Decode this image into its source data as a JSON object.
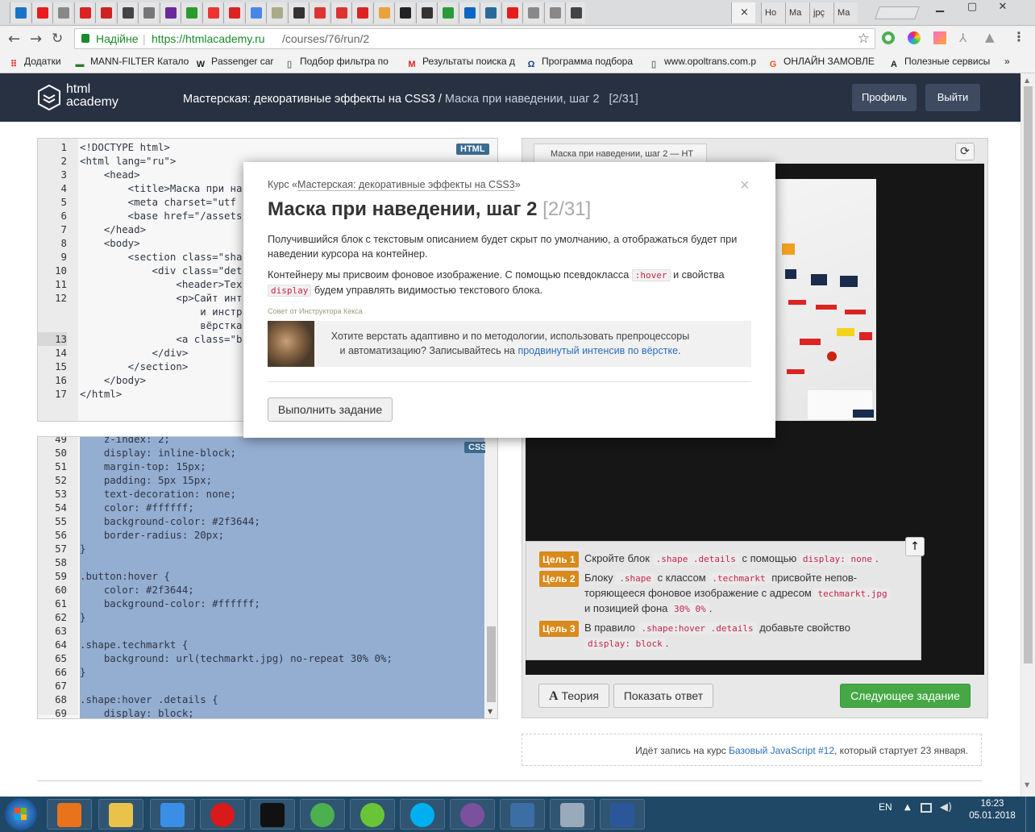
{
  "browser": {
    "tabs": [
      {
        "icon": "s",
        "color": "#1a73c7"
      },
      {
        "icon": "S",
        "color": "#e81c1c"
      },
      {
        "icon": "doc",
        "color": "#888"
      },
      {
        "icon": "M",
        "color": "#d22"
      },
      {
        "icon": "x",
        "color": "#c22"
      },
      {
        "icon": "b",
        "color": "#444"
      },
      {
        "icon": "z",
        "color": "#777"
      },
      {
        "icon": "sq",
        "color": "#6a2a9a"
      },
      {
        "icon": "F",
        "color": "#2a9a2a"
      },
      {
        "icon": "t",
        "color": "#e33"
      },
      {
        "icon": "c",
        "color": "#d22"
      },
      {
        "icon": "G",
        "color": "#4a86e8"
      },
      {
        "icon": "l",
        "color": "#aa8"
      },
      {
        "icon": "h",
        "color": "#333"
      },
      {
        "icon": "y",
        "color": "#d33"
      },
      {
        "icon": "y",
        "color": "#d33"
      },
      {
        "icon": "M",
        "color": "#d22"
      },
      {
        "icon": "o",
        "color": "#e9a33b"
      },
      {
        "icon": ">",
        "color": "#222"
      },
      {
        "icon": "h",
        "color": "#333"
      },
      {
        "icon": "up",
        "color": "#2b9a3b"
      },
      {
        "icon": "in",
        "color": "#0a66c2"
      },
      {
        "icon": "C",
        "color": "#2a6a9a"
      },
      {
        "icon": "S",
        "color": "#e81c1c"
      },
      {
        "icon": "doc",
        "color": "#888"
      },
      {
        "icon": "doc",
        "color": "#888"
      },
      {
        "icon": "sh",
        "color": "#444"
      }
    ],
    "extra_tabs": [
      "Но",
      "Ма",
      "jpç",
      "Ма"
    ],
    "security_label": "Надійне",
    "url": "https://htmlacademy.ru/courses/76/run/2",
    "url_host": "https://htmlacademy.ru",
    "url_path": "/courses/76/run/2",
    "bookmarks": [
      {
        "label": "Додатки",
        "icon": "apps",
        "color": "#d22"
      },
      {
        "label": "MANN-FILTER Катало",
        "icon": "mf",
        "color": "#2a7a2a"
      },
      {
        "label": "Passenger car",
        "icon": "wix",
        "color": "#222"
      },
      {
        "label": "Подбор фильтра по",
        "icon": "doc",
        "color": "#777"
      },
      {
        "label": "Результаты поиска д",
        "icon": "M",
        "color": "#d22"
      },
      {
        "label": "Программа подбора",
        "icon": "om",
        "color": "#1a3f8a"
      },
      {
        "label": "www.opoltrans.com.p",
        "icon": "doc",
        "color": "#777"
      },
      {
        "label": "ОНЛАЙН ЗАМОВЛЕ",
        "icon": "G",
        "color": "#e8581a"
      },
      {
        "label": "Полезные сервисы",
        "icon": "A",
        "color": "#222"
      }
    ]
  },
  "site": {
    "logo_line1": "html",
    "logo_line2": "academy",
    "course_title": "Мастерская: декоративные эффекты на CSS3",
    "separator": "/",
    "step_title": "Маска при наведении, шаг 2",
    "step_counter": "[2/31]",
    "profile_button": "Профиль",
    "logout_button": "Выйти"
  },
  "html_editor": {
    "badge": "HTML",
    "line_numbers": [
      "1",
      "2",
      "3",
      "4",
      "5",
      "6",
      "7",
      "8",
      "9",
      "10",
      "11",
      "12",
      "",
      "",
      "13",
      "14",
      "15",
      "16",
      "17"
    ],
    "lines": [
      "<!DOCTYPE html>",
      "<html lang=\"ru\">",
      "    <head>",
      "        <title>Маска при на",
      "        <meta charset=\"utf",
      "        <base href=\"/assets",
      "    </head>",
      "    <body>",
      "        <section class=\"sha",
      "            <div class=\"det",
      "                <header>Tex",
      "                <p>Сайт инт",
      "                    и инстр",
      "                    вёрстка",
      "                <a class=\"b",
      "            </div>",
      "        </section>",
      "    </body>",
      "</html>"
    ]
  },
  "css_editor": {
    "badge": "CSS",
    "line_numbers": [
      "49",
      "50",
      "51",
      "52",
      "53",
      "54",
      "55",
      "56",
      "57",
      "58",
      "59",
      "60",
      "61",
      "62",
      "63",
      "64",
      "65",
      "66",
      "67",
      "68",
      "69"
    ],
    "lines": [
      "    z-index: 2;",
      "    display: inline-block;",
      "    margin-top: 15px;",
      "    padding: 5px 15px;",
      "    text-decoration: none;",
      "    color: #ffffff;",
      "    background-color: #2f3644;",
      "    border-radius: 20px;",
      "}",
      "",
      ".button:hover {",
      "    color: #2f3644;",
      "    background-color: #ffffff;",
      "}",
      "",
      ".shape.techmarkt {",
      "    background: url(techmarkt.jpg) no-repeat 30% 0%;",
      "}",
      "",
      ".shape:hover .details {",
      "    display: block;"
    ]
  },
  "preview": {
    "tab_label": "Маска при наведении, шаг 2 — HT",
    "goals": [
      {
        "badge": "Цель 1",
        "parts": [
          {
            "t": "Скройте блок "
          },
          {
            "c": ".shape .details"
          },
          {
            "t": " с помощью "
          },
          {
            "c": "display: none"
          },
          {
            "t": "."
          }
        ]
      },
      {
        "badge": "Цель 2",
        "parts": [
          {
            "t": "Блоку "
          },
          {
            "c": ".shape"
          },
          {
            "t": " с классом "
          },
          {
            "c": ".techmarkt"
          },
          {
            "t": " присвойте непов­торяющееся фоновое изображение с адресом "
          },
          {
            "c": "techmarkt.jpg"
          },
          {
            "t": " и позицией фона "
          },
          {
            "c": "30% 0%"
          },
          {
            "t": "."
          }
        ]
      },
      {
        "badge": "Цель 3",
        "parts": [
          {
            "t": "В правило "
          },
          {
            "c": ".shape:hover .details"
          },
          {
            "t": " добавьте свойство "
          },
          {
            "c": "display: block"
          },
          {
            "t": "."
          }
        ]
      }
    ],
    "theory_button": "Теория",
    "answer_button": "Показать ответ",
    "next_button": "Следующее задание",
    "promo_text": "Идёт запись на курс ",
    "promo_link": "Базовый JavaScript #12",
    "promo_tail": ", который стартует 23 января."
  },
  "modal": {
    "course_prefix": "Курс «",
    "course_link": "Мастерская: декоративные эффекты на CSS3",
    "course_suffix": "»",
    "title": "Маска при наведении, шаг 2",
    "counter": "[2/31]",
    "para1": "Получившийся блок с текстовым описанием будет скрыт по умолчанию, а отображаться будет при наведении курсора на контейнер.",
    "para2_a": "Контейнеру мы присвоим фоновое изображение. С помощью псевдокласса ",
    "para2_code1": ":hover",
    "para2_b": " и свойства ",
    "para2_code2": "display",
    "para2_c": " будем управлять видимостью текстового блока.",
    "advice_label": "Совет от Инструктора Кекса",
    "advice_a": "Хотите верстать адаптивно и по методологии, использовать препроцессоры и автоматизацию? Записывайтесь на ",
    "advice_link": "продвинутый интенсив по вёрстке",
    "advice_b": ".",
    "close": "×",
    "action_button": "Выполнить задание"
  },
  "taskbar": {
    "lang": "EN",
    "time": "16:23",
    "date": "05.01.2018",
    "apps": [
      {
        "name": "media-player",
        "color": "#e8731a"
      },
      {
        "name": "file-explorer",
        "color": "#e8c24a"
      },
      {
        "name": "internet-explorer",
        "color": "#3a8ee6"
      },
      {
        "name": "opera",
        "color": "#d91a1a"
      },
      {
        "name": "webstorm",
        "color": "#111"
      },
      {
        "name": "chrome",
        "color": "#4caf50"
      },
      {
        "name": "icq",
        "color": "#6ac437"
      },
      {
        "name": "skype",
        "color": "#00aff0"
      },
      {
        "name": "viber",
        "color": "#7b519d"
      },
      {
        "name": "remote-desktop",
        "color": "#3a6ea5"
      },
      {
        "name": "calculator",
        "color": "#9ab"
      },
      {
        "name": "word",
        "color": "#2b579a"
      }
    ]
  }
}
